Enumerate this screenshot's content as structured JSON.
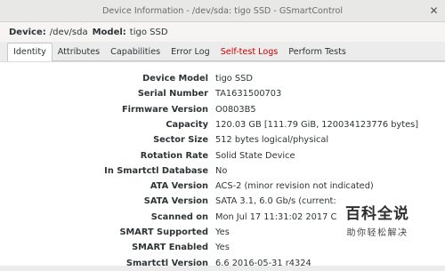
{
  "window": {
    "title": "Device Information - /dev/sda: tigo SSD - GSmartControl",
    "close_glyph": "✕"
  },
  "infobar": {
    "device_label": "Device:",
    "device_value": "/dev/sda",
    "model_label": "Model:",
    "model_value": "tigo SSD"
  },
  "tabs": [
    {
      "label": "Identity",
      "active": true
    },
    {
      "label": "Attributes"
    },
    {
      "label": "Capabilities"
    },
    {
      "label": "Error Log"
    },
    {
      "label": "Self-test Logs",
      "alert": true
    },
    {
      "label": "Perform Tests"
    }
  ],
  "identity": [
    {
      "key": "Device Model",
      "value": "tigo SSD"
    },
    {
      "key": "Serial Number",
      "value": "TA1631500703"
    },
    {
      "key": "Firmware Version",
      "value": "O0803B5"
    },
    {
      "key": "Capacity",
      "value": "120.03 GB [111.79 GiB, 120034123776 bytes]"
    },
    {
      "key": "Sector Size",
      "value": "512 bytes logical/physical"
    },
    {
      "key": "Rotation Rate",
      "value": "Solid State Device"
    },
    {
      "key": "In Smartctl Database",
      "value": "No"
    },
    {
      "key": "ATA Version",
      "value": "ACS-2 (minor revision not indicated)"
    },
    {
      "key": "SATA Version",
      "value": "SATA 3.1, 6.0 Gb/s (current:"
    },
    {
      "key": "Scanned on",
      "value": "Mon Jul 17 11:31:02 2017 C"
    },
    {
      "key": "SMART Supported",
      "value": "Yes"
    },
    {
      "key": "SMART Enabled",
      "value": "Yes"
    },
    {
      "key": "Smartctl Version",
      "value": "6.6 2016-05-31 r4324"
    }
  ],
  "watermark": {
    "logo": "百科全说",
    "subtitle": "助你轻松解决"
  }
}
